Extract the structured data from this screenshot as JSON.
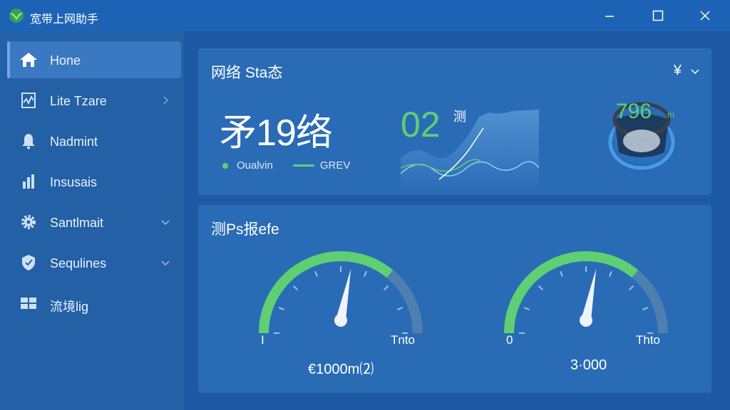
{
  "window": {
    "title": "宽带上网助手",
    "logo_icon": "leaf-logo-icon"
  },
  "sidebar": {
    "items": [
      {
        "label": "Hone",
        "icon": "home-icon",
        "active": true
      },
      {
        "label": "Lite Tzare",
        "icon": "chart-icon",
        "chevron": "right"
      },
      {
        "label": "Nadmint",
        "icon": "bell-icon"
      },
      {
        "label": "Insusais",
        "icon": "bar-chart-icon"
      },
      {
        "label": "Santlmait",
        "icon": "gear-icon",
        "chevron": "down"
      },
      {
        "label": "Sequlines",
        "icon": "shield-icon",
        "chevron": "down"
      },
      {
        "label": "流境lig",
        "icon": "grid-icon"
      }
    ]
  },
  "status_card": {
    "title": "网络 Sta态",
    "dropdown_value": "¥",
    "big_value": "矛19络",
    "legend": {
      "item1": "Oualvin",
      "item2": "GREV"
    },
    "speed_value": "02",
    "speed_unit": "测",
    "ring_value": "796",
    "ring_unit": "m"
  },
  "speed_card": {
    "title": "测Ps报efe",
    "gauges": [
      {
        "min_label": "I",
        "max_label": "Tnto",
        "value_label": "€1000m⑵",
        "level": 0.72
      },
      {
        "min_label": "0",
        "max_label": "Thto",
        "value_label": "3·000",
        "level": 0.72
      }
    ]
  },
  "colors": {
    "accent_green": "#5fcf73",
    "panel_blue": "#2a6bb6",
    "background": "#1f62ad"
  }
}
